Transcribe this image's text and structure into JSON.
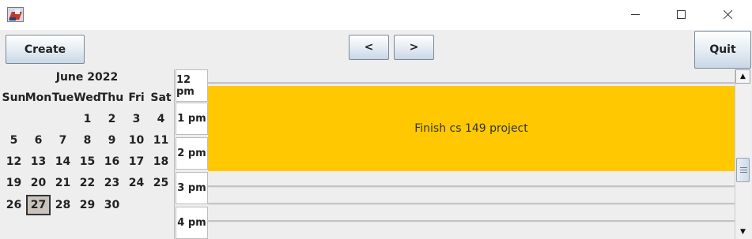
{
  "window": {
    "icons": {
      "app": "java-app-icon",
      "minimize": "minimize-icon",
      "maximize": "maximize-icon",
      "close": "close-icon"
    }
  },
  "toolbar": {
    "create_label": "Create",
    "prev_label": "<",
    "next_label": ">",
    "quit_label": "Quit"
  },
  "calendar": {
    "title": "June 2022",
    "weekdays": [
      "Sun",
      "Mon",
      "Tue",
      "Wed",
      "Thu",
      "Fri",
      "Sat"
    ],
    "weeks": [
      [
        "",
        "",
        "",
        "1",
        "2",
        "3",
        "4"
      ],
      [
        "5",
        "6",
        "7",
        "8",
        "9",
        "10",
        "11"
      ],
      [
        "12",
        "13",
        "14",
        "15",
        "16",
        "17",
        "18"
      ],
      [
        "19",
        "20",
        "21",
        "22",
        "23",
        "24",
        "25"
      ],
      [
        "26",
        "27",
        "28",
        "29",
        "30",
        "",
        ""
      ]
    ],
    "selected_day": "27"
  },
  "schedule": {
    "times": [
      "12 pm",
      "1 pm",
      "2 pm",
      "3 pm",
      "4 pm"
    ],
    "event": {
      "title": "Finish cs 149 project",
      "color": "#ffc800"
    }
  },
  "colors": {
    "background": "#eeeeee",
    "button_gradient_end": "#c9d7e6",
    "event": "#ffc800"
  },
  "scrollbar": {
    "up_icon": "scroll-up-arrow-icon",
    "down_icon": "scroll-down-arrow-icon",
    "thumb_icon": "scroll-thumb-grip-icon"
  }
}
